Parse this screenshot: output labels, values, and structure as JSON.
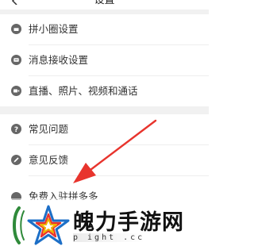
{
  "header": {
    "title": "设置"
  },
  "groups": [
    {
      "items": [
        {
          "icon": "box-icon",
          "label": "拼小圈设置"
        },
        {
          "icon": "message-icon",
          "label": "消息接收设置"
        },
        {
          "icon": "video-icon",
          "label": "直播、照片、视频和通话"
        }
      ]
    },
    {
      "items": [
        {
          "icon": "question-icon",
          "label": "常见问题"
        },
        {
          "icon": "pen-icon",
          "label": "意见反馈"
        },
        {
          "icon": "gift-icon",
          "label": "免费入驻拼多多"
        }
      ]
    }
  ],
  "annotation": {
    "arrow_color": "#e8342d"
  },
  "watermark": {
    "site_name": "魄力手游网",
    "url_fragment": "p  ight  .cc"
  },
  "colors": {
    "background": "#ffffff",
    "separator": "#f1f1f1",
    "icon": "#666666"
  }
}
